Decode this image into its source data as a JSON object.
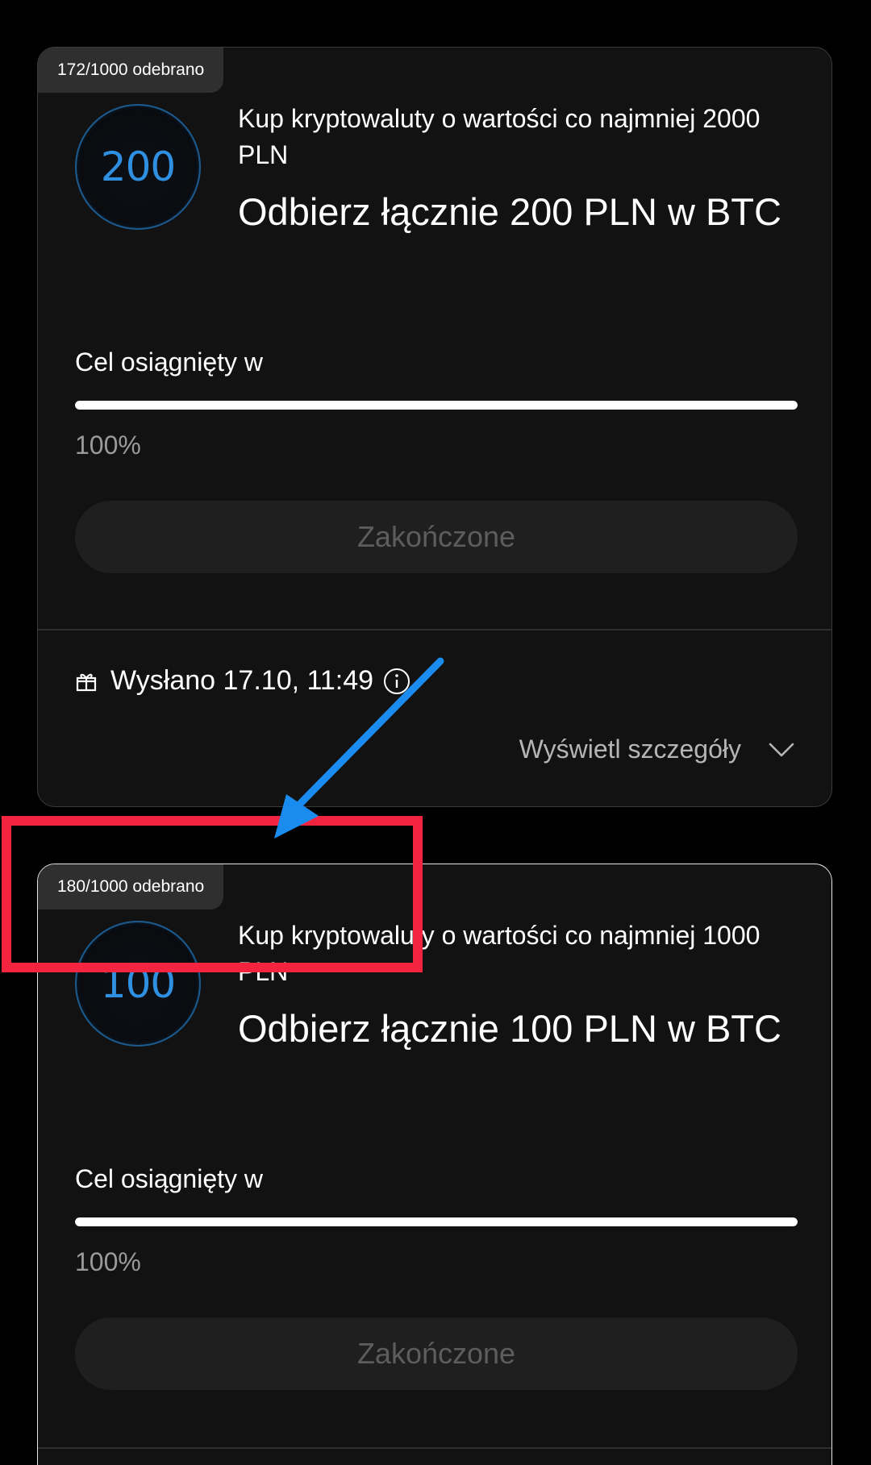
{
  "cards": [
    {
      "claimed_badge": "172/1000 odebrano",
      "coin_value": "200",
      "task_description": "Kup kryptowaluty o wartości co najmniej 2000 PLN",
      "reward_title": "Odbierz łącznie 200 PLN w BTC",
      "goal_label": "Cel osiągnięty w",
      "progress_percent": 100,
      "progress_text": "100%",
      "status_button": "Zakończone",
      "sent_text": "Wysłano 17.10, 11:49",
      "details_link": "Wyświetl szczegóły"
    },
    {
      "claimed_badge": "180/1000 odebrano",
      "coin_value": "100",
      "task_description": "Kup kryptowaluty o wartości co najmniej 1000 PLN",
      "reward_title": "Odbierz łącznie 100 PLN w BTC",
      "goal_label": "Cel osiągnięty w",
      "progress_percent": 100,
      "progress_text": "100%",
      "status_button": "Zakończone"
    }
  ],
  "icons": {
    "gift": "gift-icon",
    "info": "info-icon",
    "chevron": "chevron-down-icon"
  },
  "colors": {
    "background": "#000000",
    "card": "#121212",
    "coin_text": "#2f8fe0",
    "annotation_red": "#f2243f",
    "annotation_blue": "#1a8cf0"
  }
}
